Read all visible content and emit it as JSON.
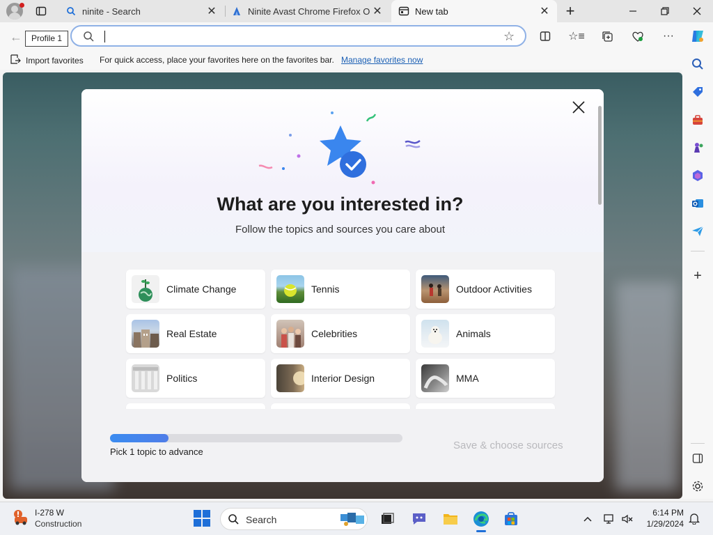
{
  "tabs": [
    {
      "title": "ninite - Search",
      "icon": "search-icon"
    },
    {
      "title": "Ninite Avast Chrome Firefox Ope",
      "icon": "ninite-icon"
    },
    {
      "title": "New tab",
      "icon": "newtab-icon"
    }
  ],
  "tooltip": "Profile 1",
  "address": {
    "value": "",
    "placeholder": ""
  },
  "favorites_bar": {
    "import_label": "Import favorites",
    "message": "For quick access, place your favorites here on the favorites bar.",
    "link": "Manage favorites now"
  },
  "dialog": {
    "title": "What are you interested in?",
    "subtitle": "Follow the topics and sources you care about",
    "topics": [
      {
        "label": "Climate Change"
      },
      {
        "label": "Tennis"
      },
      {
        "label": "Outdoor Activities"
      },
      {
        "label": "Real Estate"
      },
      {
        "label": "Celebrities"
      },
      {
        "label": "Animals"
      },
      {
        "label": "Politics"
      },
      {
        "label": "Interior Design"
      },
      {
        "label": "MMA"
      }
    ],
    "progress_fraction": 0.2,
    "progress_text": "Pick 1 topic to advance",
    "save_label": "Save & choose sources"
  },
  "taskbar": {
    "weather_line1": "I-278 W",
    "weather_line2": "Construction",
    "search_label": "Search",
    "time": "6:14 PM",
    "date": "1/29/2024"
  },
  "colors": {
    "accent": "#1e6fd8",
    "link": "#1a5fb4",
    "progress": "#3b8cf0"
  }
}
